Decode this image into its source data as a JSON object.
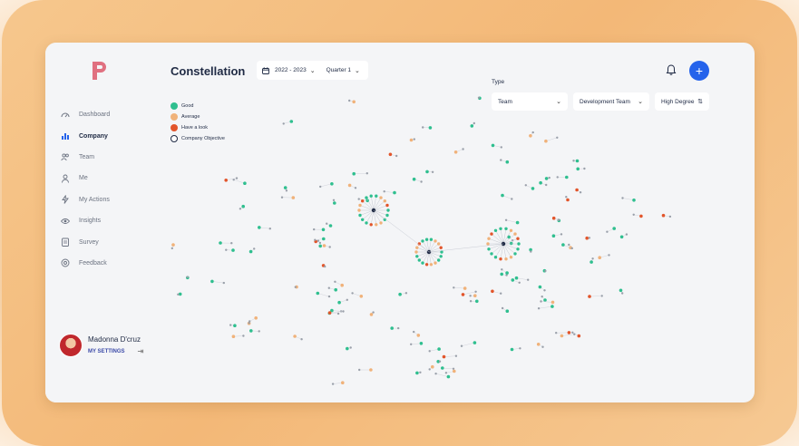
{
  "app": {
    "title": "Constellation"
  },
  "sidebar": {
    "items": [
      {
        "label": "Dashboard",
        "icon": "dashboard-icon",
        "active": false
      },
      {
        "label": "Company",
        "icon": "company-chart-icon",
        "active": true
      },
      {
        "label": "Team",
        "icon": "team-icon",
        "active": false
      },
      {
        "label": "Me",
        "icon": "person-icon",
        "active": false
      },
      {
        "label": "My Actions",
        "icon": "actions-icon",
        "active": false
      },
      {
        "label": "Insights",
        "icon": "eye-icon",
        "active": false
      },
      {
        "label": "Survey",
        "icon": "survey-icon",
        "active": false
      },
      {
        "label": "Feedback",
        "icon": "feedback-icon",
        "active": false
      }
    ]
  },
  "user": {
    "name": "Madonna D'cruz",
    "settings_label": "MY SETTINGS"
  },
  "filters": {
    "year": "2022 - 2023",
    "quarter": "Quarter 1",
    "type_label": "Type",
    "type_value": "Team",
    "team_value": "Development Team",
    "sort_value": "High Degree"
  },
  "legend": [
    {
      "label": "Good",
      "color": "#2fbf8f",
      "hollow": false
    },
    {
      "label": "Average",
      "color": "#f0b27a",
      "hollow": false
    },
    {
      "label": "Have a look",
      "color": "#e2552b",
      "hollow": false
    },
    {
      "label": "Company Objective",
      "color": "#1f2a44",
      "hollow": true
    }
  ],
  "colors": {
    "good": "#2fbf8f",
    "average": "#f0b27a",
    "have_a_look": "#e2552b",
    "accent": "#2563eb",
    "brand": "#e05a6a"
  }
}
